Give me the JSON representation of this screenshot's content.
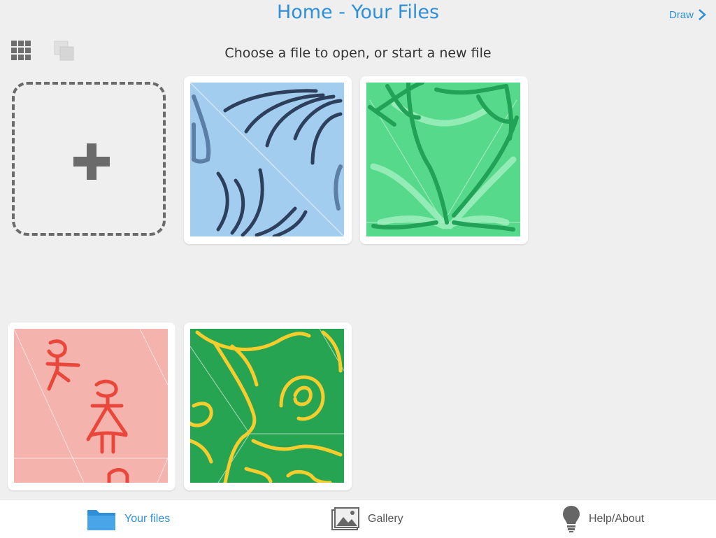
{
  "header": {
    "title": "Home - Your Files",
    "draw_label": "Draw",
    "subtitle": "Choose a file to open, or start a new file"
  },
  "toolbar": {
    "grid_view_icon": "grid-icon",
    "copy_icon": "copy-icon"
  },
  "files": [
    {
      "name": "file-1",
      "background": "#a3cdee",
      "stroke": "#2c3f5c"
    },
    {
      "name": "file-2",
      "background": "#56d98a",
      "stroke": "#21a257"
    },
    {
      "name": "file-3",
      "background": "#f5b3ad",
      "stroke": "#e9473b"
    },
    {
      "name": "file-4",
      "background": "#27a452",
      "stroke": "#f6cd2d"
    }
  ],
  "tabs": [
    {
      "label": "Your files",
      "icon": "folder-icon",
      "active": true
    },
    {
      "label": "Gallery",
      "icon": "gallery-icon",
      "active": false
    },
    {
      "label": "Help/About",
      "icon": "lightbulb-icon",
      "active": false
    }
  ],
  "colors": {
    "accent": "#2f90d7",
    "background": "#efefef"
  }
}
